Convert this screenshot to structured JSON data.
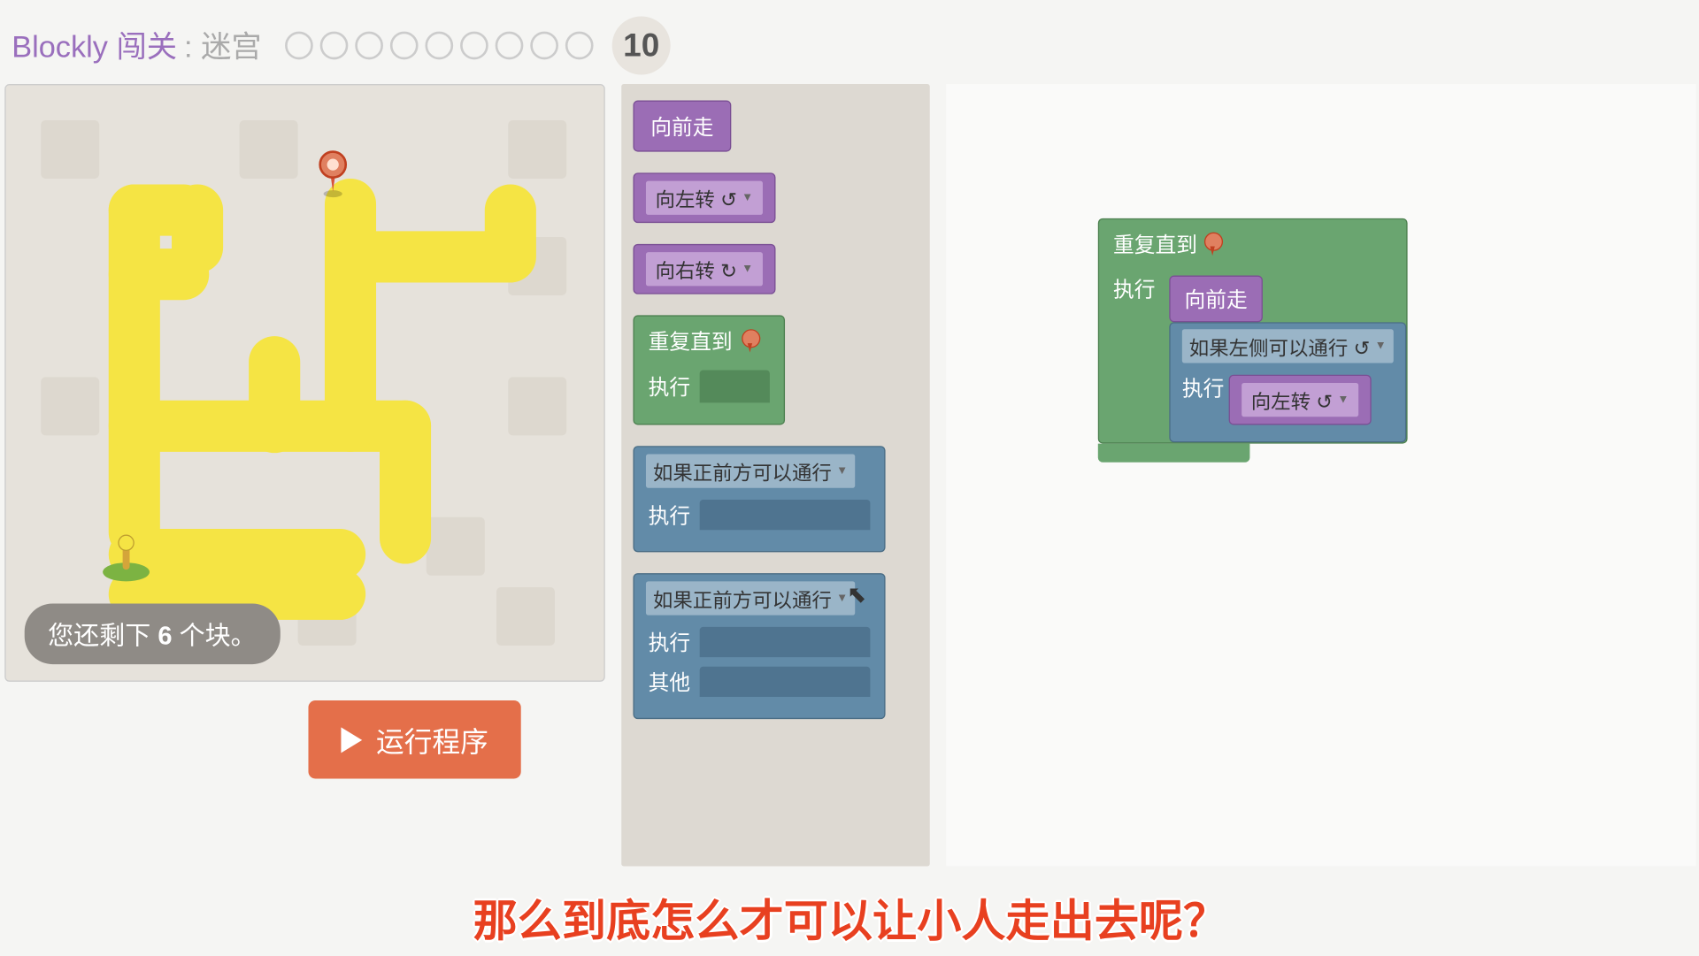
{
  "header": {
    "title": "Blockly 闯关",
    "subtitle": ": 迷宫",
    "current_level": "10",
    "total_dots": 9
  },
  "maze": {
    "remaining_prefix": "您还剩下 ",
    "remaining_count": "6",
    "remaining_suffix": " 个块。"
  },
  "run_button": "运行程序",
  "toolbox": {
    "move_forward": "向前走",
    "turn_left": "向左转 ↺",
    "turn_right": "向右转 ↻",
    "repeat_until": "重复直到",
    "do": "执行",
    "if_ahead": "如果正前方可以通行",
    "if_left": "如果左侧可以通行 ↺",
    "else": "其他"
  },
  "workspace": {
    "repeat_until": "重复直到",
    "do": "执行",
    "move_forward": "向前走",
    "if_left": "如果左侧可以通行 ↺",
    "turn_left": "向左转 ↺"
  },
  "caption": "那么到底怎么才可以让小人走出去呢？"
}
